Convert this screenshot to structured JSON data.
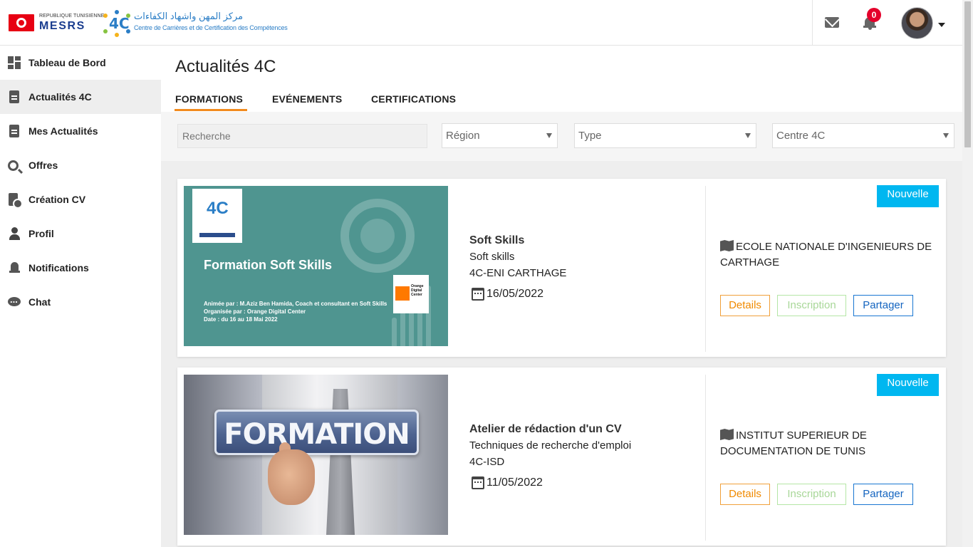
{
  "header": {
    "logo_republic": "REPUBLIQUE TUNISIENNE",
    "logo_mesrs": "MESRS",
    "logo_4c": "4C",
    "logo_arabic": "مركز المهن واشهاد الكفاءات",
    "logo_subtitle": "Centre de Carrières et de Certification des Compétences",
    "notifications_count": "0"
  },
  "sidebar": {
    "items": [
      {
        "label": "Tableau de Bord",
        "icon": "dashboard-icon"
      },
      {
        "label": "Actualités 4C",
        "icon": "document-icon",
        "active": true
      },
      {
        "label": "Mes Actualités",
        "icon": "document-icon"
      },
      {
        "label": "Offres",
        "icon": "search-icon"
      },
      {
        "label": "Création CV",
        "icon": "cv-icon"
      },
      {
        "label": "Profil",
        "icon": "user-icon"
      },
      {
        "label": "Notifications",
        "icon": "bell-icon"
      },
      {
        "label": "Chat",
        "icon": "chat-icon"
      }
    ]
  },
  "main": {
    "title": "Actualités 4C",
    "tabs": [
      {
        "label": "FORMATIONS",
        "active": true
      },
      {
        "label": "EVÉNEMENTS"
      },
      {
        "label": "CERTIFICATIONS"
      }
    ],
    "filters": {
      "search_placeholder": "Recherche",
      "region": "Région",
      "type": "Type",
      "centre": "Centre 4C"
    }
  },
  "cards": [
    {
      "title": "Soft Skills",
      "category": "Soft skills",
      "centre": "4C-ENI CARTHAGE",
      "date": "16/05/2022",
      "institution": "ECOLE NATIONALE D'INGENIEURS DE CARTHAGE",
      "badge": "Nouvelle",
      "image": {
        "logo": "4C",
        "heading": "Formation Soft Skills",
        "line1": "Animée par : M.Aziz Ben Hamida, Coach et consultant en Soft Skills",
        "line2": "Organisée par :  Orange Digital Center",
        "line3": "Date : du 16 au 18 Mai 2022",
        "partner": "Orange Digital Center"
      }
    },
    {
      "title": "Atelier de rédaction d'un CV",
      "category": "Techniques de recherche d'emploi",
      "centre": "4C-ISD",
      "date": "11/05/2022",
      "institution": "INSTITUT SUPERIEUR DE DOCUMENTATION DE TUNIS",
      "badge": "Nouvelle",
      "image": {
        "heading": "FORMATION"
      }
    }
  ],
  "buttons": {
    "details": "Details",
    "inscription": "Inscription",
    "share": "Partager"
  },
  "colors": {
    "accent_tab": "#f28b1e",
    "badge_new": "#00b7f0",
    "notif_badge": "#e4002b"
  }
}
